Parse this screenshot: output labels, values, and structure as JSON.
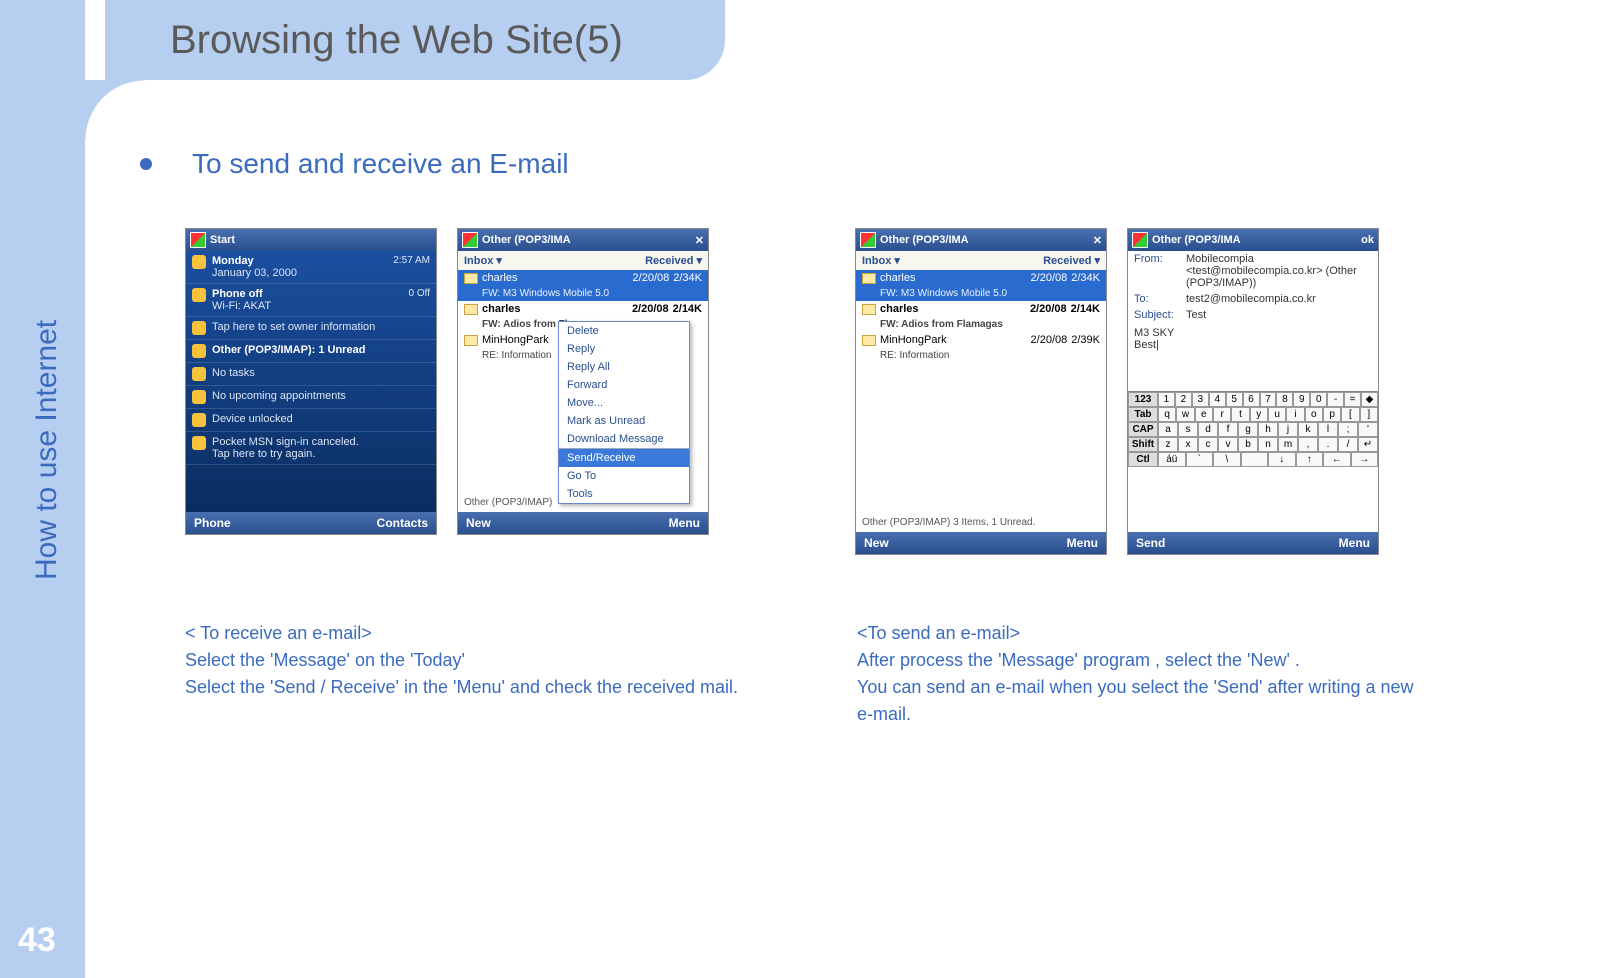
{
  "page": {
    "title": "Browsing the Web Site(5)",
    "sidebar_label": "How to use Internet",
    "page_number": "43",
    "bullet": "To send and receive an E-mail"
  },
  "today": {
    "top": "Start",
    "date_line1": "Monday",
    "date_line2": "January 03, 2000",
    "time": "2:57 AM",
    "rows": [
      {
        "main": "Phone off",
        "sub": "Wi-Fi: AKAT",
        "right": "0  Off"
      },
      {
        "main": "Tap here to set owner information",
        "sub": ""
      },
      {
        "main": "Other (POP3/IMAP): 1 Unread",
        "sub": ""
      },
      {
        "main": "No tasks",
        "sub": ""
      },
      {
        "main": "No upcoming appointments",
        "sub": ""
      },
      {
        "main": "Device unlocked",
        "sub": ""
      },
      {
        "main": "Pocket MSN sign-in canceled.",
        "sub": "Tap here to try again."
      }
    ],
    "bottom_left": "Phone",
    "bottom_right": "Contacts"
  },
  "inbox_menu": {
    "top": "Other (POP3/IMA",
    "col_left": "Inbox ▾",
    "col_right": "Received ▾",
    "mails": [
      {
        "from": "charles",
        "date": "2/20/08",
        "size": "2/34K",
        "sub": "FW: M3 Windows Mobile 5.0",
        "sel": true
      },
      {
        "from": "charles",
        "date": "2/20/08",
        "size": "2/14K",
        "sub": "FW: Adios from Flamagas",
        "sel": false,
        "bold": true
      },
      {
        "from": "MinHongPark",
        "date": "",
        "size": "",
        "sub": "RE: Information",
        "sel": false
      }
    ],
    "menu": [
      "Delete",
      "Reply",
      "Reply All",
      "Forward",
      "Move...",
      "Mark as Unread",
      "Download Message",
      "Send/Receive",
      "Go To",
      "Tools"
    ],
    "menu_hot": "Send/Receive",
    "status": "Other (POP3/IMAP)",
    "bottom_left": "New",
    "bottom_right": "Menu"
  },
  "inbox_plain": {
    "top": "Other (POP3/IMA",
    "col_left": "Inbox ▾",
    "col_right": "Received ▾",
    "mails": [
      {
        "from": "charles",
        "date": "2/20/08",
        "size": "2/34K",
        "sub": "FW: M3 Windows Mobile 5.0",
        "sel": true
      },
      {
        "from": "charles",
        "date": "2/20/08",
        "size": "2/14K",
        "sub": "FW: Adios from Flamagas",
        "sel": false,
        "bold": true
      },
      {
        "from": "MinHongPark",
        "date": "2/20/08",
        "size": "2/39K",
        "sub": "RE: Information",
        "sel": false
      }
    ],
    "status": "Other (POP3/IMAP)  3 Items, 1 Unread.",
    "bottom_left": "New",
    "bottom_right": "Menu"
  },
  "compose": {
    "top": "Other (POP3/IMA",
    "top_right": "ok",
    "from_label": "From:",
    "from_val": "Mobilecompia <test@mobilecompia.co.kr> (Other (POP3/IMAP))",
    "to_label": "To:",
    "to_val": "test2@mobilecompia.co.kr",
    "subj_label": "Subject:",
    "subj_val": "Test",
    "body": "M3 SKY\nBest|",
    "kbd": {
      "r1": [
        "123",
        "1",
        "2",
        "3",
        "4",
        "5",
        "6",
        "7",
        "8",
        "9",
        "0",
        "-",
        "=",
        "◆"
      ],
      "r2": [
        "Tab",
        "q",
        "w",
        "e",
        "r",
        "t",
        "y",
        "u",
        "i",
        "o",
        "p",
        "[",
        "]"
      ],
      "r3": [
        "CAP",
        "a",
        "s",
        "d",
        "f",
        "g",
        "h",
        "j",
        "k",
        "l",
        ";",
        "'"
      ],
      "r4": [
        "Shift",
        "z",
        "x",
        "c",
        "v",
        "b",
        "n",
        "m",
        ",",
        ".",
        "/",
        "↵"
      ],
      "r5": [
        "Ctl",
        "áü",
        "`",
        "\\",
        " ",
        "↓",
        "↑",
        "←",
        "→"
      ]
    },
    "bottom_left": "Send",
    "bottom_right": "Menu"
  },
  "captions": {
    "left_title": "< To receive an e-mail>",
    "left_l1": " Select the 'Message' on  the 'Today'",
    "left_l2": " Select the 'Send / Receive' in the 'Menu' and check the received mail.",
    "right_title": "<To send an e-mail>",
    "right_l1": " After process the 'Message' program , select the 'New' .",
    "right_l2": "You can send an e-mail when you select the 'Send' after writing a new e-mail."
  }
}
